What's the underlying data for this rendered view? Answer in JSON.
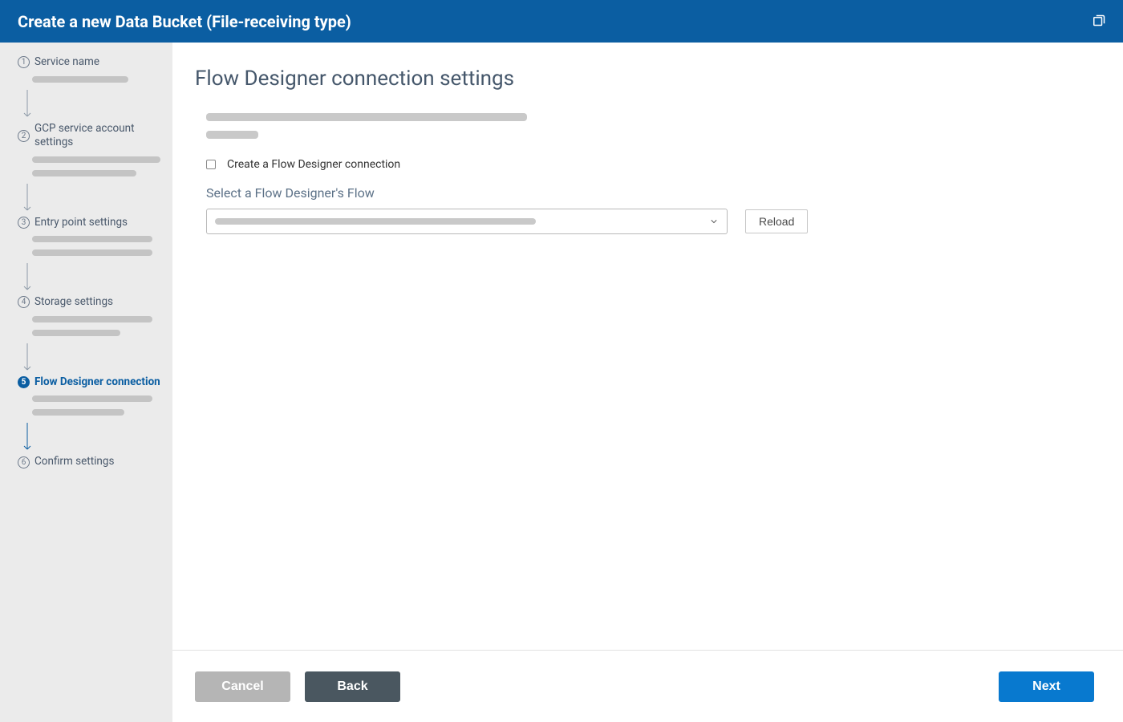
{
  "header": {
    "title": "Create a new Data Bucket (File-receiving type)"
  },
  "sidebar": {
    "steps": [
      {
        "index": "1",
        "label": "Service name"
      },
      {
        "index": "2",
        "label": "GCP service account settings"
      },
      {
        "index": "3",
        "label": "Entry point settings"
      },
      {
        "index": "4",
        "label": "Storage settings"
      },
      {
        "index": "5",
        "label": "Flow Designer connection"
      },
      {
        "index": "6",
        "label": "Confirm settings"
      }
    ],
    "activeIndex": 4
  },
  "main": {
    "title": "Flow Designer connection settings",
    "checkbox_label": "Create a Flow Designer connection",
    "select_label": "Select a Flow Designer's Flow",
    "reload_label": "Reload"
  },
  "footer": {
    "cancel": "Cancel",
    "back": "Back",
    "next": "Next"
  },
  "colors": {
    "primary": "#0b5ea2",
    "buttonPrimary": "#0879cf",
    "buttonDark": "#4a5760",
    "buttonMuted": "#b5b5b5"
  }
}
